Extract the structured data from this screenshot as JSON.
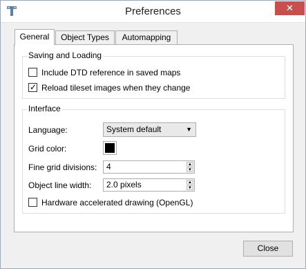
{
  "window": {
    "title": "Preferences"
  },
  "tabs": [
    {
      "label": "General",
      "active": true
    },
    {
      "label": "Object Types",
      "active": false
    },
    {
      "label": "Automapping",
      "active": false
    }
  ],
  "saving": {
    "title": "Saving and Loading",
    "dtd_label": "Include DTD reference in saved maps",
    "dtd_checked": false,
    "reload_label": "Reload tileset images when they change",
    "reload_checked": true
  },
  "interface": {
    "title": "Interface",
    "language_label": "Language:",
    "language_value": "System default",
    "grid_color_label": "Grid color:",
    "grid_color": "#000000",
    "fine_grid_label": "Fine grid divisions:",
    "fine_grid_value": "4",
    "line_width_label": "Object line width:",
    "line_width_value": "2.0 pixels",
    "opengl_label": "Hardware accelerated drawing (OpenGL)",
    "opengl_checked": false
  },
  "footer": {
    "close_label": "Close"
  },
  "icons": {
    "app": "tiled-app-icon",
    "close": "close-icon",
    "dropdown": "chevron-down-icon",
    "check": "checkmark-icon"
  }
}
